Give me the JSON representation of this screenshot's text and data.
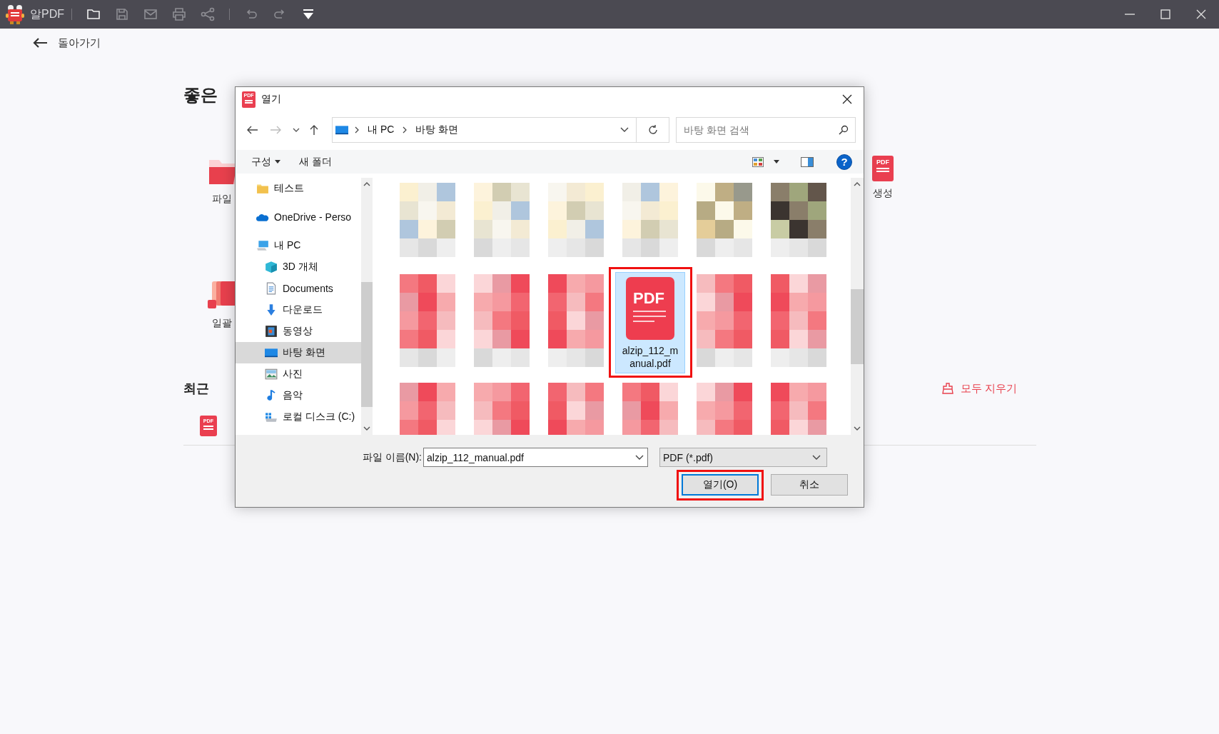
{
  "app_bar": {
    "title": "알PDF"
  },
  "back_link": {
    "label": "돌아가기"
  },
  "home": {
    "heading": "좋은",
    "tools": [
      {
        "label": "파일",
        "kind": "open"
      },
      {
        "label": "일괄",
        "kind": "batch"
      }
    ],
    "create_tool": {
      "label": "생성",
      "icon_text": "PDF"
    },
    "recent": {
      "heading": "최근",
      "clear_label": "모두 지우기",
      "item_icon_text": "PDF"
    }
  },
  "dialog": {
    "title": "열기",
    "title_icon_text": "PDF",
    "breadcrumb": [
      "내 PC",
      "바탕 화면"
    ],
    "search": {
      "placeholder": "바탕 화면 검색"
    },
    "toolbar": {
      "organize": "구성",
      "new_folder": "새 폴더",
      "help": "?"
    },
    "nav_items": [
      {
        "label": "테스트",
        "kind": "folder",
        "selected": false
      },
      {
        "label": "OneDrive - Perso",
        "kind": "cloud",
        "selected": false
      },
      {
        "label": "내 PC",
        "kind": "pc",
        "selected": false,
        "children": [
          {
            "label": "3D 개체",
            "kind": "cube",
            "selected": false
          },
          {
            "label": "Documents",
            "kind": "document",
            "selected": false
          },
          {
            "label": "다운로드",
            "kind": "download",
            "selected": false
          },
          {
            "label": "동영상",
            "kind": "video",
            "selected": false
          },
          {
            "label": "바탕 화면",
            "kind": "desktop",
            "selected": true
          },
          {
            "label": "사진",
            "kind": "pictures",
            "selected": false
          },
          {
            "label": "음악",
            "kind": "music",
            "selected": false
          },
          {
            "label": "로컬 디스크 (C:)",
            "kind": "drive",
            "selected": false
          }
        ]
      }
    ],
    "files": [
      {
        "kind": "picture",
        "selected": false
      },
      {
        "kind": "picture",
        "selected": false
      },
      {
        "kind": "picture",
        "selected": false
      },
      {
        "kind": "picture",
        "selected": false
      },
      {
        "kind": "picture",
        "selected": false
      },
      {
        "kind": "picture",
        "selected": false
      },
      {
        "kind": "picture",
        "selected": false
      },
      {
        "kind": "picture",
        "selected": false
      },
      {
        "kind": "picture",
        "selected": false
      },
      {
        "kind": "pdf",
        "name": "alzip_112_manual.pdf",
        "icon_text": "PDF",
        "selected": true,
        "highlighted": true
      },
      {
        "kind": "picture",
        "selected": false
      },
      {
        "kind": "picture",
        "selected": false
      },
      {
        "kind": "picture",
        "selected": false
      },
      {
        "kind": "picture",
        "selected": false
      },
      {
        "kind": "picture",
        "selected": false
      },
      {
        "kind": "picture",
        "selected": false
      },
      {
        "kind": "picture",
        "selected": false
      },
      {
        "kind": "picture",
        "selected": false
      }
    ],
    "file_name": {
      "label": "파일 이름(N):",
      "value": "alzip_112_manual.pdf"
    },
    "file_type": {
      "value": "PDF (*.pdf)"
    },
    "buttons": [
      {
        "label": "열기(O)",
        "default": true,
        "highlighted": true
      },
      {
        "label": "취소",
        "default": false,
        "highlighted": false
      }
    ]
  }
}
